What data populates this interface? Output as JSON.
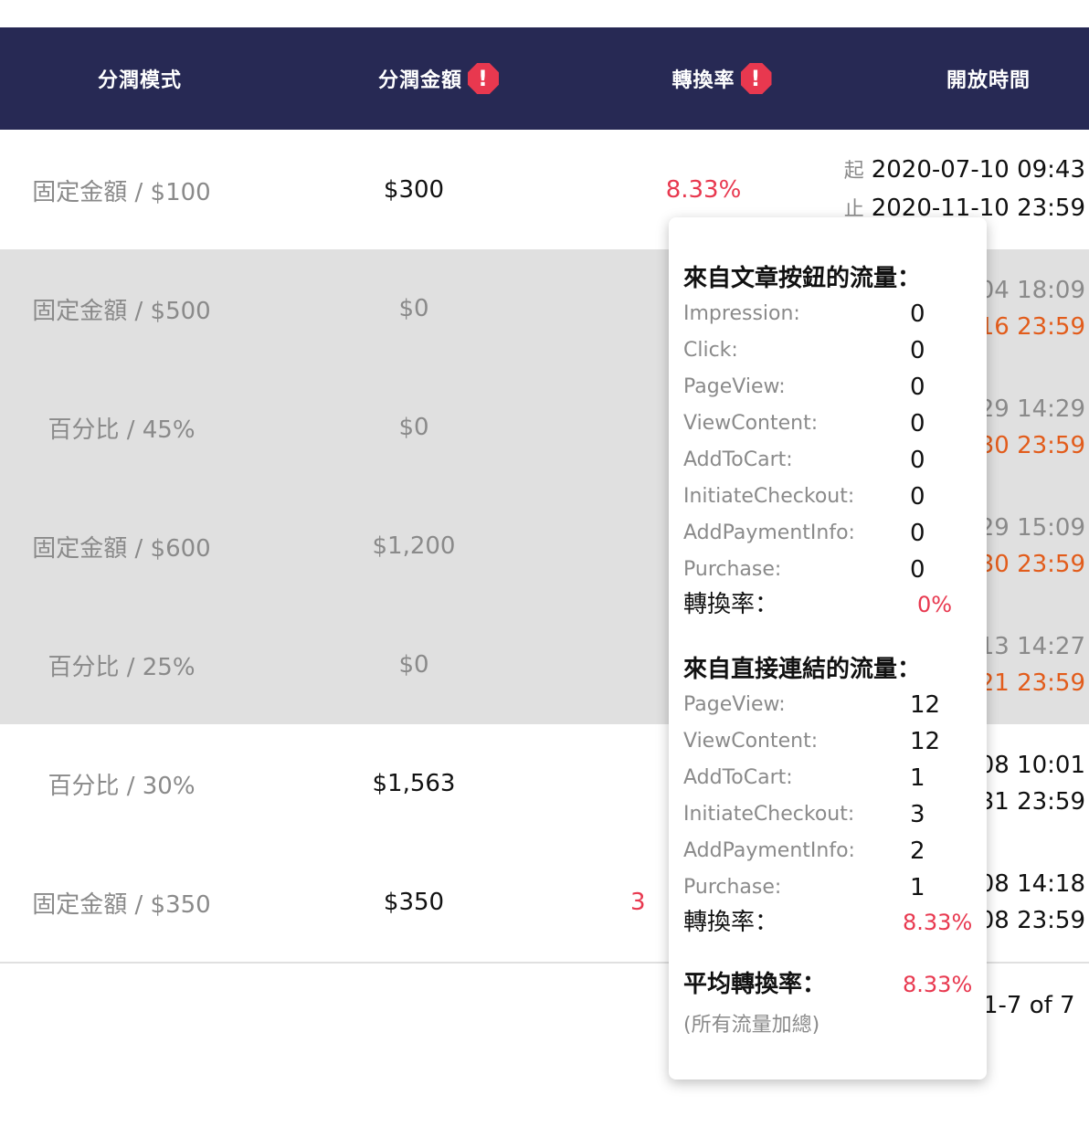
{
  "table": {
    "headers": [
      "分潤模式",
      "分潤金額",
      "轉換率",
      "開放時間"
    ],
    "rows": [
      {
        "mode": "固定金額 / $100",
        "amount": "$300",
        "rate": "8.33%",
        "start_label": "起",
        "start": "2020-07-10 09:43",
        "end_label": "止",
        "end": "2020-11-10 23:59"
      },
      {
        "mode": "固定金額 / $500",
        "amount": "$0",
        "start": "04 18:09",
        "end": "16 23:59"
      },
      {
        "mode": "百分比 / 45%",
        "amount": "$0",
        "start": "29 14:29",
        "end": "30 23:59"
      },
      {
        "mode": "固定金額 / $600",
        "amount": "$1,200",
        "start": "29 15:09",
        "end": "30 23:59"
      },
      {
        "mode": "百分比 / 25%",
        "amount": "$0",
        "start": "13 14:27",
        "end": "21 23:59"
      },
      {
        "mode": "百分比 / 30%",
        "amount": "$1,563",
        "start": "08 10:01",
        "end": "31 23:59"
      },
      {
        "mode": "固定金額 / $350",
        "amount": "$350",
        "rate": "3",
        "start": "08 14:18",
        "end": "08 23:59"
      }
    ]
  },
  "pagination": {
    "text": "1-7 of 7"
  },
  "popover": {
    "section1_title": "來自文章按鈕的流量：",
    "section1_items": [
      {
        "key": "Impression:",
        "value": "0"
      },
      {
        "key": "Click:",
        "value": "0"
      },
      {
        "key": "PageView:",
        "value": "0"
      },
      {
        "key": "ViewContent:",
        "value": "0"
      },
      {
        "key": "AddToCart:",
        "value": "0"
      },
      {
        "key": "InitiateCheckout:",
        "value": "0"
      },
      {
        "key": "AddPaymentInfo:",
        "value": "0"
      },
      {
        "key": "Purchase:",
        "value": "0"
      }
    ],
    "section1_rate_label": "轉換率：",
    "section1_rate": "0%",
    "section2_title": "來自直接連結的流量：",
    "section2_items": [
      {
        "key": "PageView:",
        "value": "12"
      },
      {
        "key": "ViewContent:",
        "value": "12"
      },
      {
        "key": "AddToCart:",
        "value": "1"
      },
      {
        "key": "InitiateCheckout:",
        "value": "3"
      },
      {
        "key": "AddPaymentInfo:",
        "value": "2"
      },
      {
        "key": "Purchase:",
        "value": "1"
      }
    ],
    "section2_rate_label": "轉換率：",
    "section2_rate": "8.33%",
    "avg_label": "平均轉換率：",
    "avg_rate": "8.33%",
    "avg_note": "(所有流量加總)"
  },
  "colors": {
    "header_bg": "#272954",
    "accent_red": "#e8384f",
    "end_orange": "#e25c1b",
    "row_grey": "#e0e0e0"
  }
}
